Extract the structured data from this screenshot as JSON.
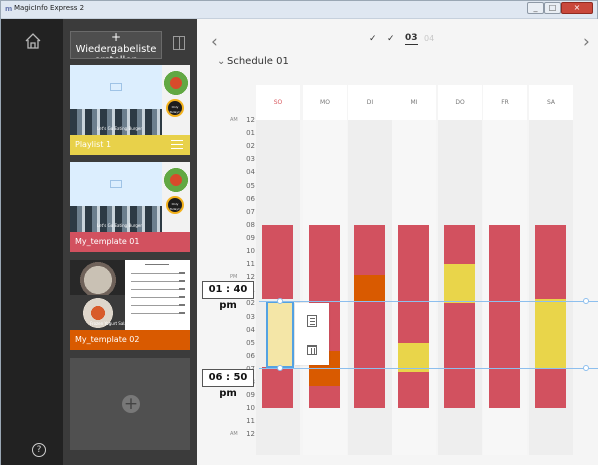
{
  "window": {
    "title": "MagicInfo Express 2",
    "logo": "m"
  },
  "sidebar": {
    "home_icon": "home-icon",
    "help_label": "?"
  },
  "playlist_panel": {
    "new_button_plus": "+",
    "new_button_label": "Wiedergabeliste erstellen",
    "toggle_icon": "panel-toggle-icon",
    "items": [
      {
        "label": "Playlist 1",
        "color": "#e8d14a",
        "badge": "Only Today!!",
        "caption": "Let's Go Eating Burger"
      },
      {
        "label": "My_template 01",
        "color": "#d2515f",
        "badge": "Only Today!!",
        "caption": "Let's Go Eating Burger"
      },
      {
        "label": "My_template 02",
        "color": "#d95a00",
        "caption": "Frozen Yogurt Salad"
      }
    ],
    "add_icon": "+"
  },
  "schedule": {
    "nav_prev": "‹",
    "nav_next": "›",
    "week_checks": [
      "✓",
      "✓"
    ],
    "current_week": "03",
    "next_week": "04",
    "toggle": "⌄",
    "title": "Schedule 01",
    "days": [
      "SO",
      "MO",
      "DI",
      "MI",
      "DO",
      "FR",
      "SA"
    ],
    "active_day_color": "#d8595e",
    "time_labels": [
      "12",
      "01",
      "02",
      "03",
      "04",
      "05",
      "06",
      "07",
      "08",
      "09",
      "10",
      "11",
      "12",
      "01",
      "02",
      "03",
      "04",
      "05",
      "06",
      "07",
      "08",
      "09",
      "10",
      "11",
      "12"
    ],
    "ampm": [
      "AM",
      "PM",
      "AM"
    ],
    "selection": {
      "start": "01 : 40 pm",
      "end": "06 : 50 pm"
    },
    "bars": [
      {
        "day": "SO",
        "color": "red",
        "from": 8,
        "to": 13.67
      },
      {
        "day": "SO",
        "color": "yellow_selected",
        "from": 13.67,
        "to": 18.83
      },
      {
        "day": "SO",
        "color": "red",
        "from": 18.83,
        "to": 22
      },
      {
        "day": "MO",
        "color": "red",
        "from": 8,
        "to": 17.6
      },
      {
        "day": "MO",
        "color": "orange",
        "from": 17.6,
        "to": 20.3
      },
      {
        "day": "MO",
        "color": "red",
        "from": 20.3,
        "to": 22
      },
      {
        "day": "DI",
        "color": "red",
        "from": 8,
        "to": 11.8
      },
      {
        "day": "DI",
        "color": "orange",
        "from": 11.8,
        "to": 13.8
      },
      {
        "day": "DI",
        "color": "red",
        "from": 13.8,
        "to": 22
      },
      {
        "day": "MI",
        "color": "red",
        "from": 8,
        "to": 17
      },
      {
        "day": "MI",
        "color": "yellow",
        "from": 17,
        "to": 19.2
      },
      {
        "day": "MI",
        "color": "red",
        "from": 19.2,
        "to": 22
      },
      {
        "day": "DO",
        "color": "red",
        "from": 8,
        "to": 11
      },
      {
        "day": "DO",
        "color": "yellow",
        "from": 11,
        "to": 14
      },
      {
        "day": "DO",
        "color": "red",
        "from": 14,
        "to": 22
      },
      {
        "day": "FR",
        "color": "red",
        "from": 8,
        "to": 22
      },
      {
        "day": "SA",
        "color": "red",
        "from": 8,
        "to": 13.7
      },
      {
        "day": "SA",
        "color": "yellow",
        "from": 13.7,
        "to": 18.9
      },
      {
        "day": "SA",
        "color": "red",
        "from": 18.9,
        "to": 22
      }
    ],
    "action_icons": [
      "copy-icon",
      "trash-icon"
    ]
  }
}
